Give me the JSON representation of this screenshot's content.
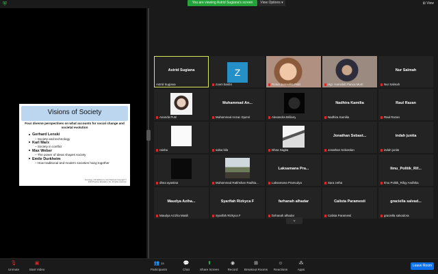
{
  "banner": {
    "sharing_text": "You are viewing Astrid Sugiana's screen",
    "view_options": "View Options",
    "view": "View"
  },
  "slide": {
    "title": "Visions of Society",
    "subtitle": "Four diverse perspectives on what accounts for social change and societal evolution",
    "items": [
      {
        "name": "Gerhard Lenski",
        "sub": "– Society and technology"
      },
      {
        "name": "Karl Marx",
        "sub": "– Society in conflict"
      },
      {
        "name": "Max Weber",
        "sub": "– The power of ideas shapes society"
      },
      {
        "name": "Emile Durkheim",
        "sub": "– How traditional and modern societies hang together"
      }
    ],
    "footer": "Sociology, 11th Edition by John Macionis Copyright © 2010 Pearson Education, Inc. All rights reserved."
  },
  "participants": [
    {
      "big": "Astrid Sugiana",
      "caption": "Astrid Sugiana",
      "muted": false,
      "active": true,
      "kind": "name"
    },
    {
      "big": "Z",
      "caption": "zoom bas04",
      "muted": true,
      "kind": "avatar"
    },
    {
      "big": "",
      "caption": "Rotua Jamaulita Putri",
      "muted": true,
      "kind": "photo-girl"
    },
    {
      "big": "",
      "caption": "Hgr. Hamidah Panca Murti",
      "muted": true,
      "kind": "photo-hijab"
    },
    {
      "big": "Nur Salmah",
      "caption": "Nur Salmah",
      "muted": true,
      "kind": "name"
    },
    {
      "big": "",
      "caption": "Ananda Putri",
      "muted": true,
      "kind": "photo-white"
    },
    {
      "big": "Muhammad  An...",
      "caption": "Muhammad Anzac Djumri",
      "muted": true,
      "kind": "name"
    },
    {
      "big": "",
      "caption": "Alexandra Briliany",
      "muted": true,
      "kind": "photo-cat"
    },
    {
      "big": "Nadhira Kamilia",
      "caption": "Nadhira Kamilia",
      "muted": true,
      "kind": "name"
    },
    {
      "big": "Raul Razan",
      "caption": "Raul Razan",
      "muted": true,
      "kind": "name"
    },
    {
      "big": "",
      "caption": "raisha",
      "muted": true,
      "kind": "photo-blank"
    },
    {
      "big": "",
      "caption": "salsa bila",
      "muted": true,
      "kind": "none"
    },
    {
      "big": "",
      "caption": "Dhea Sagita",
      "muted": true,
      "kind": "photo-sketch"
    },
    {
      "big": "Jonathan  Sebast...",
      "caption": "Jonathan Sebastian",
      "muted": true,
      "kind": "name"
    },
    {
      "big": "indah junita",
      "caption": "indah junita",
      "muted": true,
      "kind": "name"
    },
    {
      "big": "",
      "caption": "dhea ayastina",
      "muted": true,
      "kind": "photo-dark"
    },
    {
      "big": "",
      "caption": "Muhammad Rakhshan Radhia...",
      "muted": true,
      "kind": "photo-outdoor"
    },
    {
      "big": "Laksamana  Pra...",
      "caption": "Laksamana Pramudya",
      "muted": true,
      "kind": "name"
    },
    {
      "big": "",
      "caption": "Sara zetha",
      "muted": true,
      "kind": "none"
    },
    {
      "big": "Ilmu_Politik_Rif...",
      "caption": "Ilmu Politik_Rifqy Andhika",
      "muted": true,
      "kind": "name"
    },
    {
      "big": "Maudya  Aziha...",
      "caption": "Maudya Azizha Masili",
      "muted": true,
      "kind": "name"
    },
    {
      "big": "Syarifah Rizkyca F",
      "caption": "Syarifah Rizkyca F",
      "muted": true,
      "kind": "name"
    },
    {
      "big": "farhanah alhadar",
      "caption": "farhanah alhadar",
      "muted": true,
      "kind": "name"
    },
    {
      "big": "Calista Paramesti",
      "caption": "Calista Paramesti",
      "muted": true,
      "kind": "name"
    },
    {
      "big": "graciella  salvad...",
      "caption": "graciella salvadora",
      "muted": true,
      "kind": "name"
    }
  ],
  "toolbar": {
    "unmute": "Unmute",
    "start_video": "Start Video",
    "participants": "Participants",
    "participants_count": "33",
    "chat": "Chat",
    "share_screen": "Share Screen",
    "record": "Record",
    "breakout_rooms": "Breakout Rooms",
    "reactions": "Reactions",
    "apps": "Apps",
    "leave": "Leave Room"
  },
  "colors": {
    "active_border": "#d9ea58",
    "share_green": "#23a33a",
    "leave_blue": "#0e72ed",
    "muted_red": "#e02828"
  }
}
